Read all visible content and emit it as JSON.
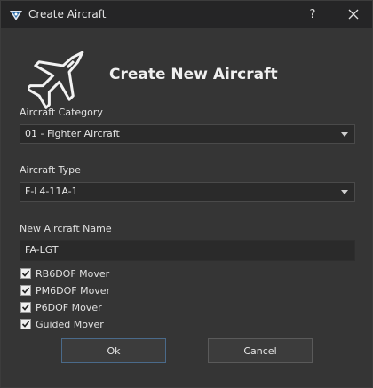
{
  "window": {
    "title": "Create Aircraft",
    "help_label": "?",
    "close_label": "✕"
  },
  "header": {
    "icon": "fighter-jet-icon",
    "title": "Create New Aircraft"
  },
  "category": {
    "label": "Aircraft Category",
    "value": "01 - Fighter Aircraft"
  },
  "type": {
    "label": "Aircraft Type",
    "value": "F-L4-11A-1"
  },
  "name": {
    "label": "New Aircraft Name",
    "value": "FA-LGT"
  },
  "movers": [
    {
      "label": "RB6DOF Mover",
      "checked": true
    },
    {
      "label": "PM6DOF Mover",
      "checked": true
    },
    {
      "label": "P6DOF Mover",
      "checked": true
    },
    {
      "label": "Guided Mover",
      "checked": true
    }
  ],
  "buttons": {
    "ok": "Ok",
    "cancel": "Cancel"
  }
}
